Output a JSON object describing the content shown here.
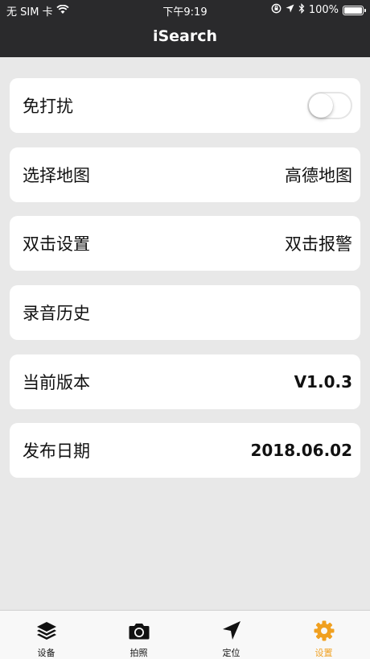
{
  "status_bar": {
    "carrier": "无 SIM 卡",
    "time": "下午9:19",
    "battery": "100%"
  },
  "header": {
    "title": "iSearch"
  },
  "settings": [
    {
      "label": "免打扰",
      "value": "",
      "control": "toggle",
      "toggle_on": false
    },
    {
      "label": "选择地图",
      "value": "高德地图"
    },
    {
      "label": "双击设置",
      "value": "双击报警"
    },
    {
      "label": "录音历史",
      "value": ""
    },
    {
      "label": "当前版本",
      "value": "V1.0.3"
    },
    {
      "label": "发布日期",
      "value": "2018.06.02"
    }
  ],
  "tabs": [
    {
      "label": "设备",
      "icon": "layers-icon"
    },
    {
      "label": "拍照",
      "icon": "camera-icon"
    },
    {
      "label": "定位",
      "icon": "location-arrow-icon"
    },
    {
      "label": "设置",
      "icon": "gear-icon",
      "active": true
    }
  ],
  "colors": {
    "header_bg": "#2a2a2c",
    "active_tab": "#f0a020",
    "card_bg": "#ffffff",
    "content_bg": "#e8e8e8"
  }
}
